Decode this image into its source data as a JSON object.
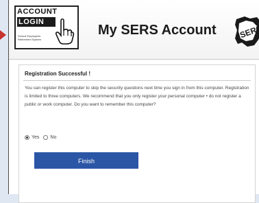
{
  "header": {
    "logo_line1": "ACCOUNT",
    "logo_line2": "LOGIN",
    "logo_subtext": "School Employees Retirement System",
    "title": "My SERS Account",
    "seal_text": "SERS"
  },
  "panel": {
    "heading": "Registration Successful !",
    "message": "You can register this computer to skip the security questions next time you sign in from this computer. Registration is limited to three computers. We recommend that you only register your personal computer • do not register a public or work computer. Do you want to remember this computer?",
    "options": [
      {
        "label": "Yes",
        "selected": true
      },
      {
        "label": "No",
        "selected": false
      }
    ],
    "finish_label": "Finish"
  },
  "colors": {
    "accent": "#2a56a5",
    "pointer_arrow": "#c8322d"
  }
}
